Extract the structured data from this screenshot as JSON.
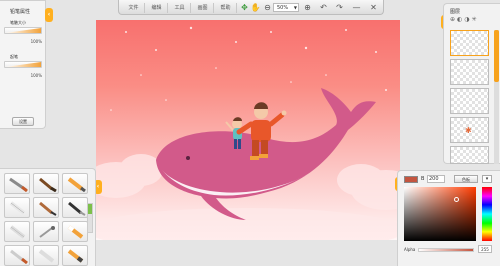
{
  "toolbar": {
    "menus": [
      "文件",
      "编辑",
      "工具",
      "画图",
      "帮助"
    ],
    "zoom": "50%"
  },
  "brush_panel": {
    "title": "铅笔属性",
    "size_label": "笔触大小",
    "size_value": "100%",
    "size_level": 1.0,
    "opacity_label": "起笔",
    "opacity_value": "100%",
    "opacity_level": 1.0,
    "settings_label": "设置"
  },
  "layers_panel": {
    "title": "图层",
    "layer_count": 5
  },
  "color_panel": {
    "mode_label": "B",
    "value": "200",
    "preset_label": "色板",
    "alpha_label": "Alpha",
    "alpha_value": "255",
    "current_color": "#c4553f"
  },
  "tools_panel": {
    "tools": [
      "pencil-icon",
      "brush-icon",
      "marker-icon",
      "eraser-icon",
      "ink-pen-icon",
      "fountain-pen-icon",
      "spray-icon",
      "smudge-icon",
      "crayon-icon",
      "fill-icon",
      "blur-icon",
      "stamp-icon"
    ]
  },
  "colors": {
    "accent": "#ffb01f",
    "whale": "#d25a8a",
    "sky_top": "#f8706e"
  }
}
